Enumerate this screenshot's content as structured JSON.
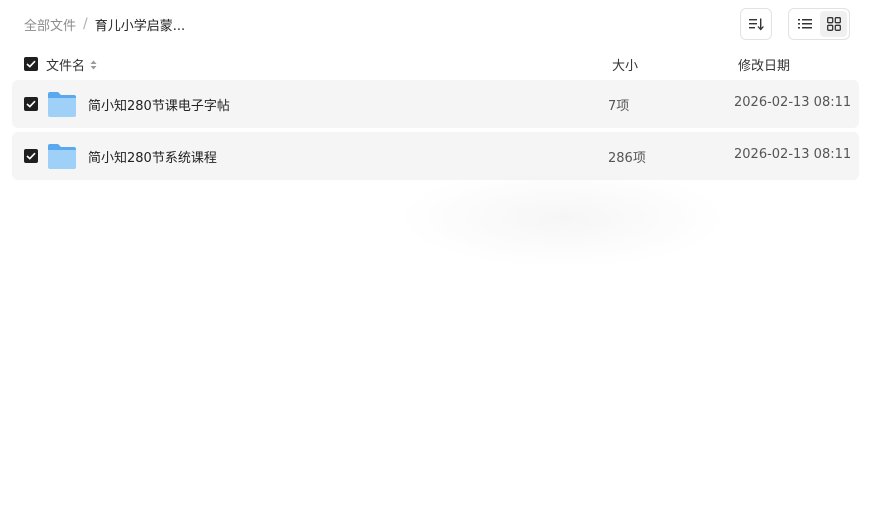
{
  "breadcrumb": {
    "root": "全部文件",
    "separator": "/",
    "current": "育儿小学启蒙..."
  },
  "toolbar": {
    "sort_icon": "sort-icon",
    "list_view_icon": "list-view-icon",
    "grid_view_icon": "grid-view-icon"
  },
  "header": {
    "name": "文件名",
    "size": "大小",
    "date": "修改日期"
  },
  "files": [
    {
      "name": "简小知280节课电子字帖",
      "size": "7项",
      "date": "2026-02-13 08:11",
      "checked": true
    },
    {
      "name": "简小知280节系统课程",
      "size": "286项",
      "date": "2026-02-13 08:11",
      "checked": true
    }
  ],
  "colors": {
    "checkbox": "#1f1f1f",
    "row_bg": "#f5f5f5",
    "folder_light": "#9fd0f7",
    "folder_dark": "#5aa9ee"
  }
}
